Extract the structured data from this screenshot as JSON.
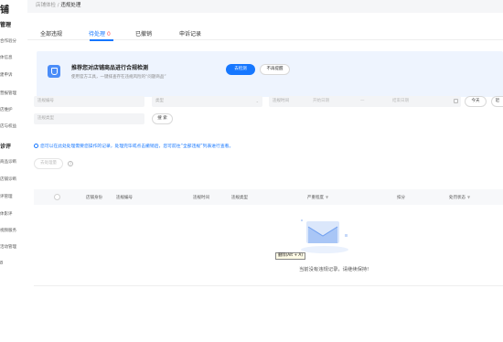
{
  "sidebar": {
    "brand": "铺",
    "section1": "管理",
    "items1": [
      "合作验分",
      "体信息",
      "建申诉",
      "营报管理",
      "店维护",
      "店与权益"
    ],
    "section2": "诊评",
    "items2": [
      "商品诊断",
      "店铺诊断",
      "评管理",
      "体影评",
      "视频服务",
      "活动管理"
    ],
    "dot": "8"
  },
  "breadcrumb": {
    "parent": "店铺体检",
    "sep": " / ",
    "current": "违规处理"
  },
  "tabs": [
    {
      "label": "全部违规",
      "count": ""
    },
    {
      "label": "待处理",
      "count": "0"
    },
    {
      "label": "已撤销",
      "count": ""
    },
    {
      "label": "申诉记录",
      "count": ""
    }
  ],
  "banner": {
    "title": "推荐您对店铺商品进行合规检测",
    "desc": "使用官方工具，一键排查存在违规风险的“问题商品”",
    "primary_button": "去检测",
    "ghost_button": "不再提醒"
  },
  "filters": {
    "order_no_placeholder": "违规编号",
    "category_placeholder": "类型",
    "time_label": "违规时间",
    "start_placeholder": "开始日期",
    "date_sep": "—",
    "end_placeholder": "结束日期",
    "today_button": "今天",
    "more_button": "近",
    "type_placeholder": "违规类型",
    "search_button": "搜 索"
  },
  "tip": "您可以在此处处理需要您操作的记录，处理完毕或点击撤销后，您可前往“全部违规”列表进行查看。",
  "batch_button": "去处理量",
  "table": {
    "headers": [
      "店铺身份",
      "违规编号",
      "违规时间",
      "违规类型",
      "严重程度",
      "扣分",
      "处罚状态"
    ]
  },
  "empty": {
    "tooltip": "删除(Alt + A)",
    "text": "当前没有违规记录，请继续保持!"
  }
}
